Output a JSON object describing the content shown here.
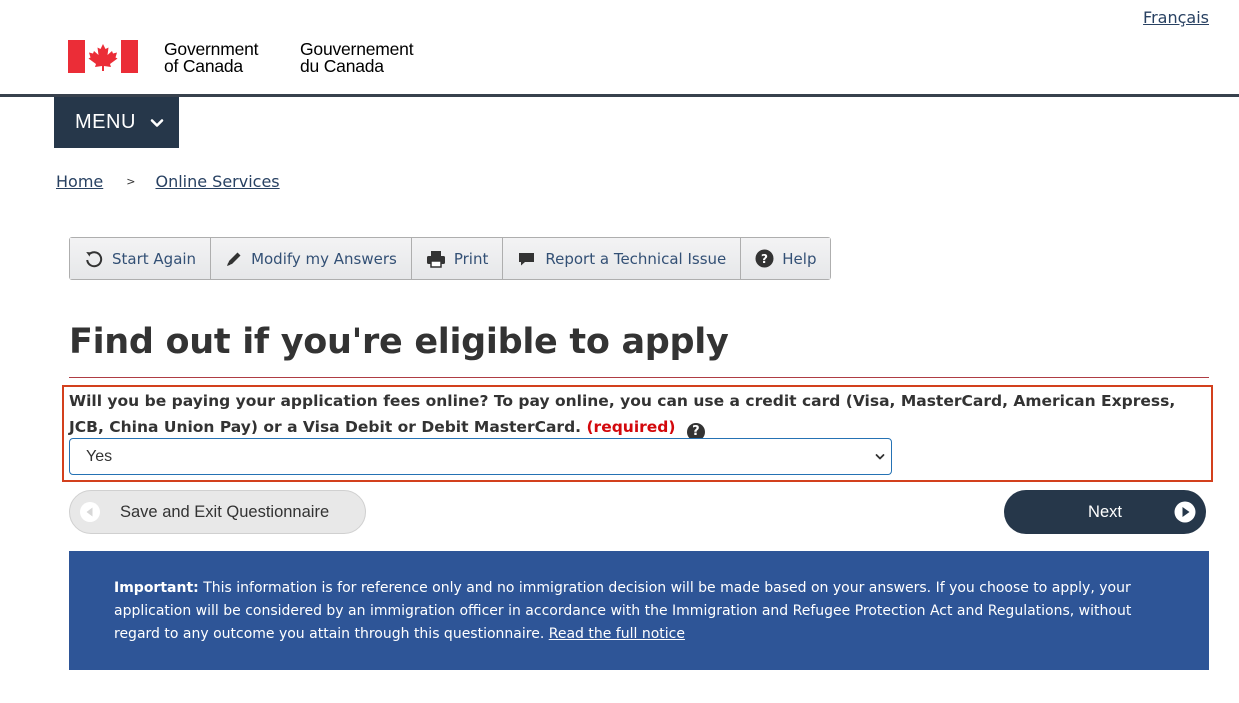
{
  "header": {
    "language_link": "Français",
    "signature_en_line1": "Government",
    "signature_en_line2": "of Canada",
    "signature_fr_line1": "Gouvernement",
    "signature_fr_line2": "du Canada",
    "flag_icon": "canada-flag-icon"
  },
  "menu": {
    "label": "MENU",
    "icon": "chevron-down-icon"
  },
  "breadcrumb": {
    "items": [
      "Home",
      "Online Services"
    ],
    "separator": ">"
  },
  "toolbar": {
    "start_again": "Start Again",
    "modify_answers": "Modify my Answers",
    "print": "Print",
    "report_issue": "Report a Technical Issue",
    "help": "Help"
  },
  "page": {
    "title": "Find out if you're eligible to apply"
  },
  "question": {
    "text": "Will you be paying your application fees online?  To pay online, you can use a credit card (Visa, MasterCard, American Express, JCB, China Union Pay) or a Visa Debit or Debit MasterCard.",
    "required_label": "(required)",
    "help_glyph": "?",
    "selected_value": "Yes"
  },
  "actions": {
    "save_exit": "Save and Exit Questionnaire",
    "next": "Next"
  },
  "notice": {
    "label": "Important:",
    "body": "This information is for reference only and no immigration decision will be made based on your answers. If you choose to apply, your application will be considered by an immigration officer in accordance with the Immigration and Refugee Protection Act and Regulations, without regard to any outcome you attain through this questionnaire.",
    "link": "Read the full notice"
  },
  "colors": {
    "menu_bg": "#26374a",
    "notice_bg": "#2e5597",
    "required": "#d3080c",
    "highlight_border": "#d3401d",
    "flag_red": "#eb2d37"
  }
}
